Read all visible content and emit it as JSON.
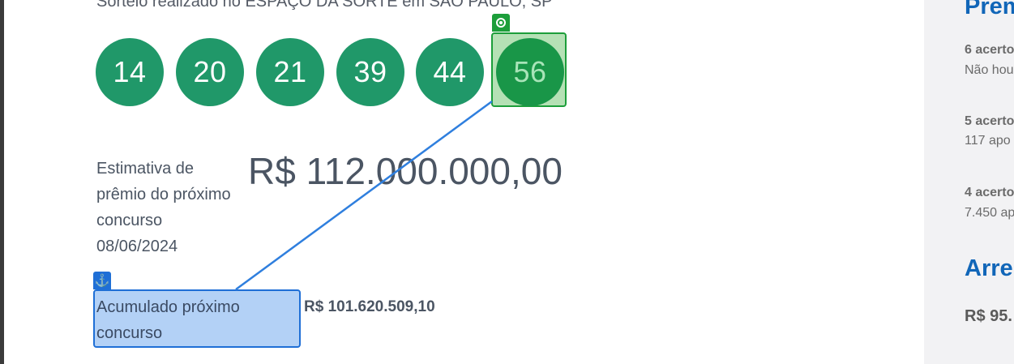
{
  "draw": {
    "location_text": "Sorteio realizado no ESPAÇO DA SORTE em SÃO PAULO, SP",
    "numbers": [
      "14",
      "20",
      "21",
      "39",
      "44",
      "56"
    ]
  },
  "estimate": {
    "label_line1": "Estimativa de",
    "label_line2": "prêmio do próximo",
    "label_line3": "concurso",
    "label_line4": "08/06/2024",
    "value": "R$ 112.000.000,00"
  },
  "accumulated": {
    "label_line1": "Acumulado próximo",
    "label_line2": "concurso",
    "value": "R$ 101.620.509,10"
  },
  "annotations": {
    "target_icon": "target-icon",
    "anchor_icon": "anchor-icon",
    "anchor_glyph": "⚓",
    "target_color": "#1c9e3a",
    "anchor_color": "#1f6fd6"
  },
  "sidebar": {
    "prizes_title": "Prem",
    "tier6_label": "6 acerto",
    "tier6_text": "Não hou",
    "tier5_label": "5 acerto",
    "tier5_text": "117 apo",
    "tier4_label": "4 acerto",
    "tier4_text": "7.450 ap",
    "collection_title": "Arre",
    "collection_value": "R$ 95."
  },
  "colors": {
    "ball": "#209869",
    "sidebar_title": "#1166b8",
    "text": "#4b5563"
  }
}
